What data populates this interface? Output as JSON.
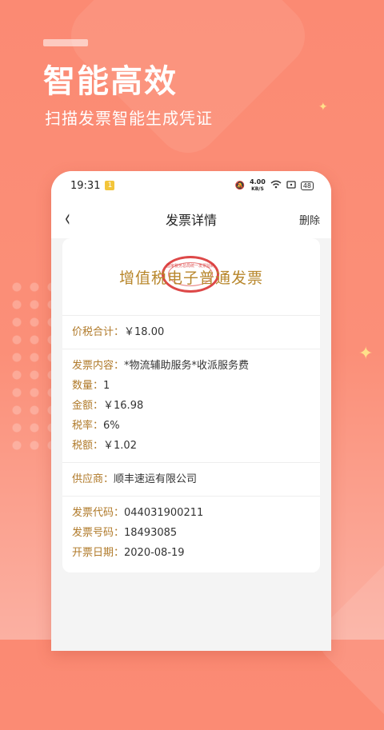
{
  "promo": {
    "headline": "智能高效",
    "subheadline": "扫描发票智能生成凭证"
  },
  "status_bar": {
    "time": "19:31",
    "notification_badge": "1",
    "net_speed_value": "4.00",
    "net_speed_unit": "KB/S",
    "battery": "48"
  },
  "nav": {
    "back_icon": "‹",
    "title": "发票详情",
    "delete_label": "删除"
  },
  "invoice": {
    "type": "增值税电子普通发票",
    "seal_text": "国家税务总局统一发票监制",
    "total": {
      "label": "价税合计：",
      "value": "￥18.00"
    },
    "content": {
      "label": "发票内容：",
      "value": "*物流辅助服务*收派服务费"
    },
    "quantity": {
      "label": "数量：",
      "value": "1"
    },
    "amount": {
      "label": "金额：",
      "value": "￥16.98"
    },
    "tax_rate": {
      "label": "税率：",
      "value": "6%"
    },
    "tax_amount": {
      "label": "税额：",
      "value": "￥1.02"
    },
    "supplier": {
      "label": "供应商：",
      "value": "顺丰速运有限公司"
    },
    "invoice_code": {
      "label": "发票代码：",
      "value": "044031900211"
    },
    "invoice_number": {
      "label": "发票号码：",
      "value": "18493085"
    },
    "issue_date": {
      "label": "开票日期：",
      "value": "2020-08-19"
    }
  }
}
